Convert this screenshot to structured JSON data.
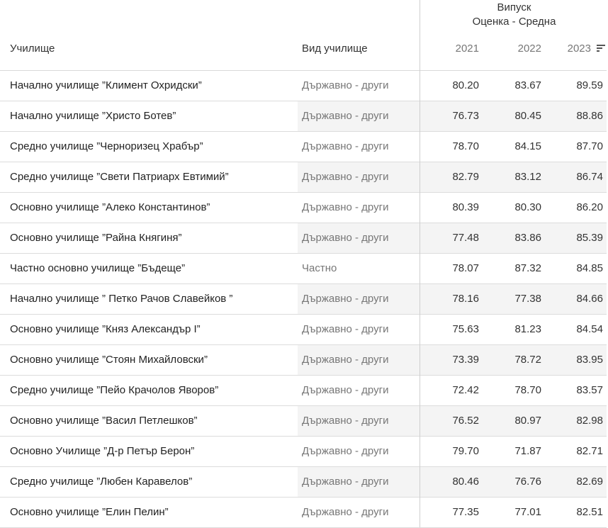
{
  "header": {
    "group_title": "Випуск",
    "measure_title": "Оценка - Средна",
    "col_school": "Училище",
    "col_type": "Вид училище",
    "years": [
      "2021",
      "2022",
      "2023"
    ]
  },
  "rows": [
    {
      "school": "Начално училище ”Климент Охридски”",
      "type": "Държавно - други",
      "v2021": "80.20",
      "v2022": "83.67",
      "v2023": "89.59",
      "shaded": false
    },
    {
      "school": "Начално училище ”Христо Ботев”",
      "type": "Държавно - други",
      "v2021": "76.73",
      "v2022": "80.45",
      "v2023": "88.86",
      "shaded": true
    },
    {
      "school": "Средно училище ”Черноризец Храбър”",
      "type": "Държавно - други",
      "v2021": "78.70",
      "v2022": "84.15",
      "v2023": "87.70",
      "shaded": false
    },
    {
      "school": "Средно училище ”Свети Патриарх Евтимий”",
      "type": "Държавно - други",
      "v2021": "82.79",
      "v2022": "83.12",
      "v2023": "86.74",
      "shaded": true
    },
    {
      "school": "Основно училище ”Алеко Константинов”",
      "type": "Държавно - други",
      "v2021": "80.39",
      "v2022": "80.30",
      "v2023": "86.20",
      "shaded": false
    },
    {
      "school": "Основно училище ”Райна Княгиня”",
      "type": "Държавно - други",
      "v2021": "77.48",
      "v2022": "83.86",
      "v2023": "85.39",
      "shaded": true
    },
    {
      "school": "Частно основно училище ”Бъдеще”",
      "type": "Частно",
      "v2021": "78.07",
      "v2022": "87.32",
      "v2023": "84.85",
      "shaded": false
    },
    {
      "school": "Начално училище ” Петко Рачов Славейков ”",
      "type": "Държавно - други",
      "v2021": "78.16",
      "v2022": "77.38",
      "v2023": "84.66",
      "shaded": true
    },
    {
      "school": "Основно училище ”Княз Александър I”",
      "type": "Държавно - други",
      "v2021": "75.63",
      "v2022": "81.23",
      "v2023": "84.54",
      "shaded": false
    },
    {
      "school": "Основно училище ”Стоян Михайловски”",
      "type": "Държавно - други",
      "v2021": "73.39",
      "v2022": "78.72",
      "v2023": "83.95",
      "shaded": true
    },
    {
      "school": "Средно училище ”Пейо Крачолов Яворов”",
      "type": "Държавно - други",
      "v2021": "72.42",
      "v2022": "78.70",
      "v2023": "83.57",
      "shaded": false
    },
    {
      "school": "Основно училище ”Васил Петлешков”",
      "type": "Държавно - други",
      "v2021": "76.52",
      "v2022": "80.97",
      "v2023": "82.98",
      "shaded": true
    },
    {
      "school": "Основно Училище ”Д-р Петър Берон”",
      "type": "Държавно - други",
      "v2021": "79.70",
      "v2022": "71.87",
      "v2023": "82.71",
      "shaded": false
    },
    {
      "school": "Средно училище ”Любен Каравелов”",
      "type": "Държавно - други",
      "v2021": "80.46",
      "v2022": "76.76",
      "v2023": "82.69",
      "shaded": true
    },
    {
      "school": "Основно училище ”Елин Пелин”",
      "type": "Държавно - други",
      "v2021": "77.35",
      "v2022": "77.01",
      "v2023": "82.51",
      "shaded": false
    }
  ]
}
